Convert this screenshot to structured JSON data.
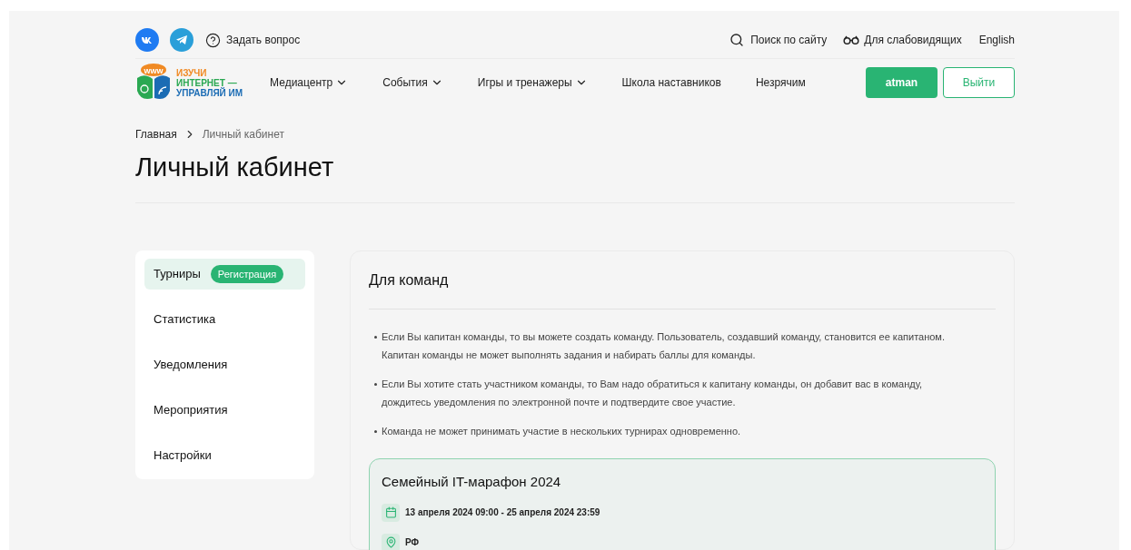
{
  "topbar": {
    "ask": "Задать вопрос",
    "search": "Поиск по сайту",
    "low_vision": "Для слабовидящих",
    "language": "English"
  },
  "logo": {
    "badge": "www",
    "lines": [
      "ИЗУЧИ",
      "ИНТЕРНЕТ —",
      "УПРАВЛЯЙ ИМ"
    ]
  },
  "nav": [
    {
      "label": "Медиацентр",
      "dropdown": true
    },
    {
      "label": "События",
      "dropdown": true
    },
    {
      "label": "Игры и тренажеры",
      "dropdown": true
    },
    {
      "label": "Школа наставников",
      "dropdown": false
    },
    {
      "label": "Незрячим",
      "dropdown": false
    }
  ],
  "user_button": "atman",
  "logout_button": "Выйти",
  "breadcrumbs": [
    "Главная",
    "Личный кабинет"
  ],
  "page_title": "Личный кабинет",
  "sidebar": {
    "items": [
      {
        "label": "Турниры",
        "selected": true,
        "badge": "Регистрация"
      },
      {
        "label": "Статистика",
        "selected": false
      },
      {
        "label": "Уведомления",
        "selected": false
      },
      {
        "label": "Мероприятия",
        "selected": false
      },
      {
        "label": "Настройки",
        "selected": false
      }
    ]
  },
  "panel": {
    "title": "Для команд",
    "rules": [
      "Если Вы капитан команды, то вы можете создать команду. Пользователь, создавший команду, становится ее капитаном. Капитан команды не может выполнять задания и набирать баллы для команды.",
      "Если Вы хотите стать участником команды, то Вам надо обратиться к капитану команды, он добавит вас в команду, дождитесь уведомления по электронной почте и подтвердите свое участие.",
      "Команда не может принимать участие в нескольких турнирах одновременно."
    ],
    "tournament": {
      "title": "Семейный IT-марафон 2024",
      "dates": "13 апреля 2024 09:00 - 25 апреля 2024 23:59",
      "place": "РФ"
    }
  }
}
